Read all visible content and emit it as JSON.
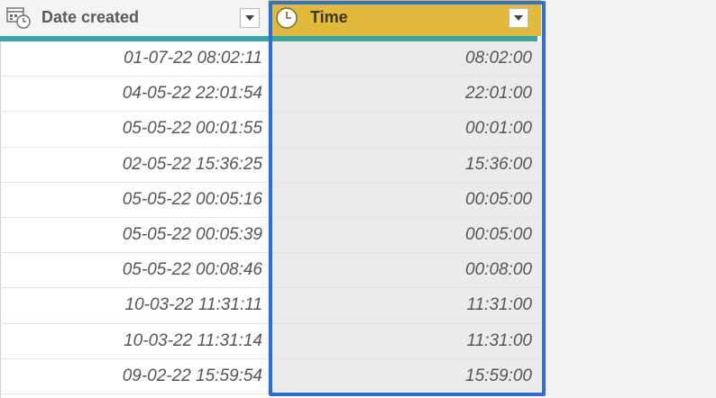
{
  "colors": {
    "time_header_bg": "#e1b93c",
    "teal_bar": "#3aa6a2",
    "highlight_border": "#2f6fd0"
  },
  "columns": [
    {
      "label": "Date created",
      "type_icon": "datetime-icon"
    },
    {
      "label": "Time",
      "type_icon": "clock-icon"
    }
  ],
  "rows": [
    {
      "date_created": "01-07-22 08:02:11",
      "time": "08:02:00"
    },
    {
      "date_created": "04-05-22 22:01:54",
      "time": "22:01:00"
    },
    {
      "date_created": "05-05-22 00:01:55",
      "time": "00:01:00"
    },
    {
      "date_created": "02-05-22 15:36:25",
      "time": "15:36:00"
    },
    {
      "date_created": "05-05-22 00:05:16",
      "time": "00:05:00"
    },
    {
      "date_created": "05-05-22 00:05:39",
      "time": "00:05:00"
    },
    {
      "date_created": "05-05-22 00:08:46",
      "time": "00:08:00"
    },
    {
      "date_created": "10-03-22 11:31:11",
      "time": "11:31:00"
    },
    {
      "date_created": "10-03-22 11:31:14",
      "time": "11:31:00"
    },
    {
      "date_created": "09-02-22 15:59:54",
      "time": "15:59:00"
    }
  ]
}
